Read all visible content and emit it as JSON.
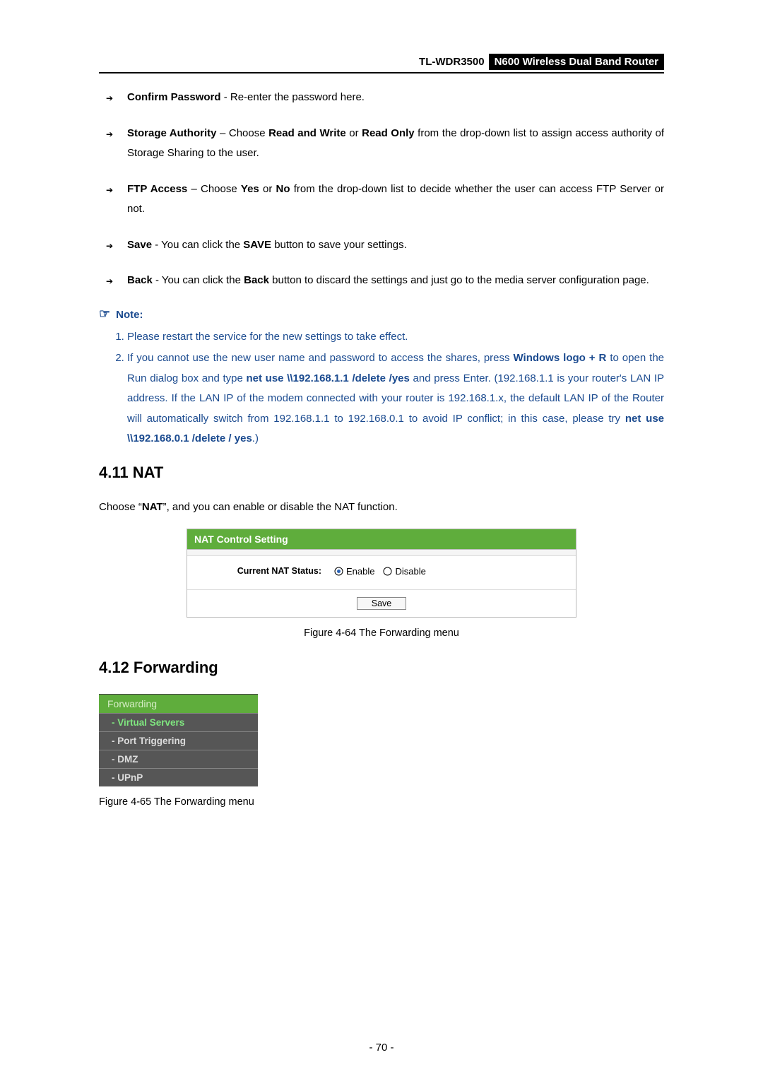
{
  "header": {
    "model": "TL-WDR3500",
    "desc": "N600 Wireless Dual Band Router"
  },
  "bullets": [
    {
      "label": "Confirm Password",
      "sep": " - ",
      "text": "Re-enter the password here."
    },
    {
      "label": "Storage Authority",
      "sep": " – ",
      "richText": "Choose <b>Read and Write</b> or <b>Read Only</b> from the drop-down list to assign access authority of Storage Sharing to the user."
    },
    {
      "label": "FTP Access",
      "sep": " – ",
      "richText": "Choose <b>Yes</b> or <b>No</b> from the drop-down list to decide whether the user can access FTP Server or not."
    },
    {
      "label": "Save",
      "sep": " - ",
      "richText": "You can click the <b>SAVE</b> button to save your settings."
    },
    {
      "label": "Back",
      "sep": " - ",
      "richText": "You can click the <b>Back</b> button to discard the settings and just go to the media server configuration page."
    }
  ],
  "note": {
    "heading": "Note:",
    "items": [
      {
        "html": "Please restart the service for the new settings to take effect."
      },
      {
        "html": "If you cannot use the new user name and password to access the shares, press <b>Windows logo + R</b> to open the Run dialog box and type <b>net use \\\\192.168.1.1 /delete /yes</b> and press Enter. (192.168.1.1 is your router's LAN IP address. If the LAN IP of the modem connected with your router is 192.168.1.x, the default LAN IP of the Router will automatically switch from 192.168.1.1 to 192.168.0.1 to avoid IP conflict; in this case, please try <b>net use \\\\192.168.0.1 /delete / yes</b>.)"
      }
    ]
  },
  "sections": {
    "nat": {
      "title": "4.11  NAT",
      "intro_prefix": "Choose “",
      "intro_bold": "NAT",
      "intro_suffix": "”, and you can enable or disable the NAT function.",
      "panel": {
        "title": "NAT Control Setting",
        "field_label": "Current NAT Status:",
        "options": {
          "enable": "Enable",
          "disable": "Disable"
        },
        "save_btn": "Save"
      },
      "figure_caption": "Figure 4-64 The Forwarding menu"
    },
    "forwarding": {
      "title": "4.12  Forwarding",
      "menu": {
        "header": "Forwarding",
        "items": [
          {
            "label": "- Virtual Servers",
            "active": true
          },
          {
            "label": "- Port Triggering",
            "active": false
          },
          {
            "label": "- DMZ",
            "active": false
          },
          {
            "label": "- UPnP",
            "active": false
          }
        ]
      },
      "figure_caption": "Figure 4-65 The Forwarding menu"
    }
  },
  "page_number": "- 70 -",
  "chart_data": {
    "type": "table",
    "title": "NAT Control Setting",
    "fields": [
      {
        "name": "Current NAT Status",
        "options": [
          "Enable",
          "Disable"
        ],
        "selected": "Enable"
      }
    ]
  }
}
